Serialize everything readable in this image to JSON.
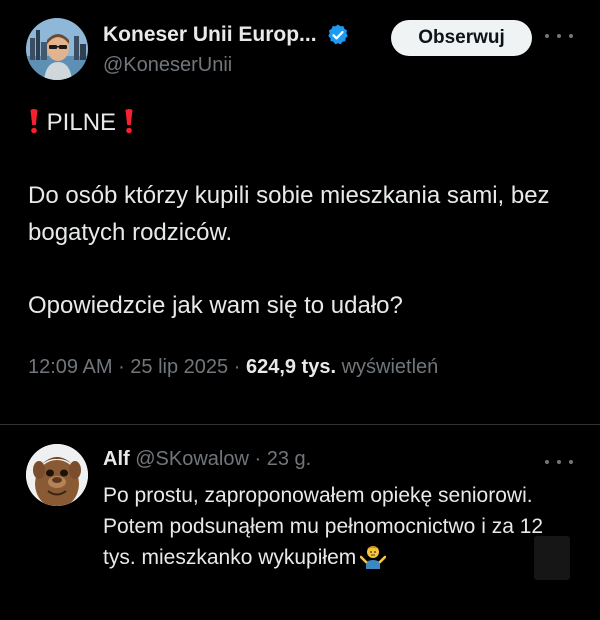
{
  "tweet": {
    "author": {
      "display_name": "Koneser Unii Europ...",
      "handle": "@KoneserUnii",
      "verified_icon": "verified-badge-icon"
    },
    "follow_label": "Obserwuj",
    "text": {
      "headline": "PILNE",
      "paragraph_1": "Do osób którzy kupili sobie mieszkania sami, bez bogatych rodziców.",
      "paragraph_2": "Opowiedzcie jak wam się to udało?"
    },
    "meta": {
      "time": "12:09 AM",
      "date": "25 lip 2025",
      "separator": " · ",
      "views_count": "624,9 tys.",
      "views_label": "wyświetleń"
    }
  },
  "reply": {
    "author": {
      "display_name": "Alf",
      "handle": "@SKowalow",
      "separator": " · ",
      "time": "23 g."
    },
    "text": "Po prostu, zaproponowałem opiekę seniorowi. Potem podsunąłem mu pełnomocnictwo i za 12 tys. mieszkanko wykupiłem",
    "emoji": "person-shrugging-emoji"
  },
  "colors": {
    "background": "#000000",
    "text_primary": "#e7e9ea",
    "text_secondary": "#71767b",
    "verified_blue": "#1d9bf0",
    "alert_red": "#f4212e",
    "button_bg": "#eff3f4",
    "divider": "#2f3336"
  }
}
